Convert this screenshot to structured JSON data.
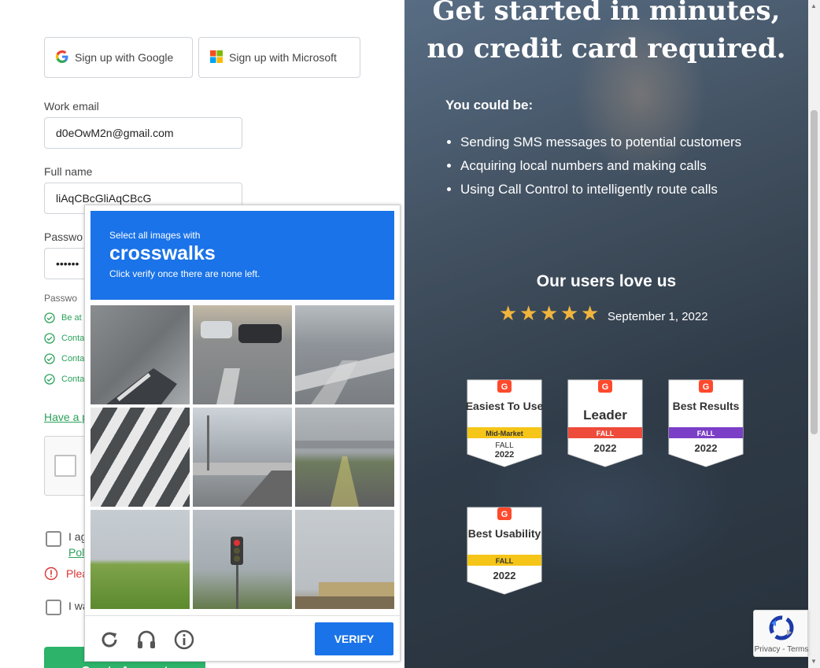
{
  "sso": {
    "google_label": "Sign up with Google",
    "microsoft_label": "Sign up with Microsoft"
  },
  "form": {
    "email_label": "Work email",
    "email_value": "d0eOwM2n@gmail.com",
    "name_label": "Full name",
    "name_value": "liAqCBcGliAqCBcG",
    "password_label": "Passwo",
    "password_value": "••••••",
    "password_hint": "Passwo",
    "rules": [
      "Be at",
      "Conta",
      "Conta",
      "Conta"
    ],
    "have_promo": "Have a p"
  },
  "agree": {
    "text": "I ag",
    "link": "Pol",
    "error": "Plea",
    "want": "I wa"
  },
  "create_button": "Create Account",
  "hero": {
    "line1": "Get started in minutes,",
    "line2": "no credit card required.",
    "could_be": "You could be:",
    "bullets": [
      "Sending SMS messages to potential customers",
      "Acquiring local numbers and making calls",
      "Using Call Control to intelligently route calls"
    ],
    "love": "Our users love us",
    "rating": 5,
    "date": "September 1, 2022"
  },
  "badges": [
    {
      "title": "Easiest To Use",
      "sub": "Mid-Market",
      "season": "FALL",
      "year": "2022",
      "color": "#f5c518"
    },
    {
      "title": "Leader",
      "sub": "",
      "season": "FALL",
      "year": "2022",
      "color": "#ee4b3b"
    },
    {
      "title": "Best Results",
      "sub": "",
      "season": "FALL",
      "year": "2022",
      "color": "#7b3fc7"
    },
    {
      "title": "Best Usability",
      "sub": "",
      "season": "FALL",
      "year": "2022",
      "color": "#f5c518"
    }
  ],
  "challenge": {
    "line1": "Select all images with",
    "keyword": "crosswalks",
    "line3": "Click verify once there are none left.",
    "verify_label": "VERIFY"
  },
  "recaptcha_badge": "Privacy - Terms",
  "colors": {
    "accent_green": "#2db36a",
    "captcha_blue": "#1a73e8"
  }
}
